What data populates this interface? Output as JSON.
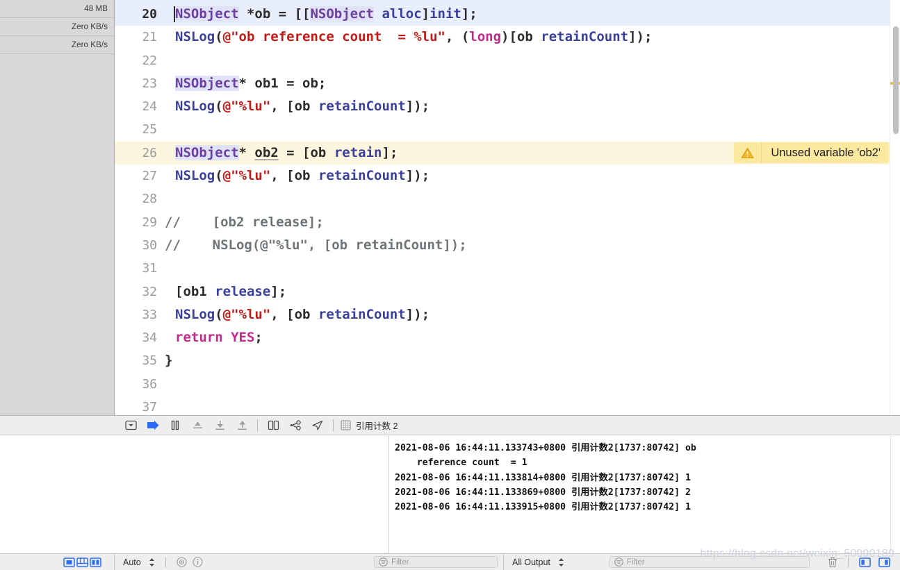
{
  "window": {
    "app": "Xcode",
    "project_breadcrumb": "引用计数 2"
  },
  "left_panel": {
    "name": "debug-gauges",
    "gauges": [
      {
        "value": "48 MB"
      },
      {
        "value": "Zero KB/s"
      },
      {
        "value": "Zero KB/s"
      }
    ]
  },
  "editor": {
    "language": "Objective-C",
    "selected_line": 20,
    "warning_line": 26,
    "partial_top_line_text": "   ...  ;",
    "lines": [
      {
        "num": "20",
        "state": "selected",
        "caret": true,
        "tokens": [
          {
            "t": "NSObject",
            "c": "t-cls-hl"
          },
          {
            "t": " *ob = [[",
            "c": "t-plain"
          },
          {
            "t": "NSObject",
            "c": "t-cls-hl"
          },
          {
            "t": " ",
            "c": "t-plain"
          },
          {
            "t": "alloc",
            "c": "t-call"
          },
          {
            "t": "]",
            "c": "t-plain"
          },
          {
            "t": "init",
            "c": "t-call"
          },
          {
            "t": "];",
            "c": "t-plain"
          }
        ]
      },
      {
        "num": "21",
        "state": "normal",
        "tokens": [
          {
            "t": "NSLog",
            "c": "t-call"
          },
          {
            "t": "(",
            "c": "t-plain"
          },
          {
            "t": "@\"ob reference count  = %lu\"",
            "c": "t-str"
          },
          {
            "t": ", (",
            "c": "t-plain"
          },
          {
            "t": "long",
            "c": "t-kw"
          },
          {
            "t": ")[ob ",
            "c": "t-plain"
          },
          {
            "t": "retainCount",
            "c": "t-call"
          },
          {
            "t": "]);",
            "c": "t-plain"
          }
        ]
      },
      {
        "num": "22",
        "state": "normal",
        "tokens": []
      },
      {
        "num": "23",
        "state": "normal",
        "tokens": [
          {
            "t": "NSObject",
            "c": "t-cls-hl"
          },
          {
            "t": "* ob1 = ob;",
            "c": "t-plain"
          }
        ]
      },
      {
        "num": "24",
        "state": "normal",
        "tokens": [
          {
            "t": "NSLog",
            "c": "t-call"
          },
          {
            "t": "(",
            "c": "t-plain"
          },
          {
            "t": "@\"%lu\"",
            "c": "t-str"
          },
          {
            "t": ", [ob ",
            "c": "t-plain"
          },
          {
            "t": "retainCount",
            "c": "t-call"
          },
          {
            "t": "]);",
            "c": "t-plain"
          }
        ]
      },
      {
        "num": "25",
        "state": "normal",
        "tokens": []
      },
      {
        "num": "26",
        "state": "warning",
        "tokens": [
          {
            "t": "NSObject",
            "c": "t-cls-hl"
          },
          {
            "t": "* ",
            "c": "t-plain"
          },
          {
            "t": "ob2",
            "c": "t-plain t-und"
          },
          {
            "t": " = [ob ",
            "c": "t-plain"
          },
          {
            "t": "retain",
            "c": "t-call"
          },
          {
            "t": "];",
            "c": "t-plain"
          }
        ]
      },
      {
        "num": "27",
        "state": "normal",
        "tokens": [
          {
            "t": "NSLog",
            "c": "t-call"
          },
          {
            "t": "(",
            "c": "t-plain"
          },
          {
            "t": "@\"%lu\"",
            "c": "t-str"
          },
          {
            "t": ", [ob ",
            "c": "t-plain"
          },
          {
            "t": "retainCount",
            "c": "t-call"
          },
          {
            "t": "]);",
            "c": "t-plain"
          }
        ]
      },
      {
        "num": "28",
        "state": "normal",
        "tokens": []
      },
      {
        "num": "29",
        "state": "normal",
        "nopad": true,
        "tokens": [
          {
            "t": "//    [ob2 release];",
            "c": "t-cmt"
          }
        ]
      },
      {
        "num": "30",
        "state": "normal",
        "nopad": true,
        "tokens": [
          {
            "t": "//    NSLog(@\"%lu\", [ob retainCount]);",
            "c": "t-cmt"
          }
        ]
      },
      {
        "num": "31",
        "state": "normal",
        "tokens": []
      },
      {
        "num": "32",
        "state": "normal",
        "tokens": [
          {
            "t": "[ob1 ",
            "c": "t-plain"
          },
          {
            "t": "release",
            "c": "t-call"
          },
          {
            "t": "];",
            "c": "t-plain"
          }
        ]
      },
      {
        "num": "33",
        "state": "normal",
        "tokens": [
          {
            "t": "NSLog",
            "c": "t-call"
          },
          {
            "t": "(",
            "c": "t-plain"
          },
          {
            "t": "@\"%lu\"",
            "c": "t-str"
          },
          {
            "t": ", [ob ",
            "c": "t-plain"
          },
          {
            "t": "retainCount",
            "c": "t-call"
          },
          {
            "t": "]);",
            "c": "t-plain"
          }
        ]
      },
      {
        "num": "34",
        "state": "normal",
        "tokens": [
          {
            "t": "return",
            "c": "t-kw"
          },
          {
            "t": " ",
            "c": "t-plain"
          },
          {
            "t": "YES",
            "c": "t-kw"
          },
          {
            "t": ";",
            "c": "t-plain"
          }
        ]
      },
      {
        "num": "35",
        "state": "normal",
        "nopad": true,
        "tokens": [
          {
            "t": "}",
            "c": "t-plain"
          }
        ]
      },
      {
        "num": "36",
        "state": "normal",
        "tokens": []
      },
      {
        "num": "37",
        "state": "normal",
        "tokens": []
      }
    ],
    "warning": {
      "icon": "warning-triangle-icon",
      "message": "Unused variable 'ob2'",
      "bg_color": "#fbe9a0"
    }
  },
  "debug_toolbar": {
    "buttons": [
      {
        "name": "hide-debug-area-button",
        "icon": "chevron-down-box-icon"
      },
      {
        "name": "continue-button",
        "icon": "continue-arrow-icon",
        "color": "#2d6df6"
      },
      {
        "name": "pause-button",
        "icon": "pause-bars-icon"
      },
      {
        "name": "step-over-button",
        "icon": "step-over-icon"
      },
      {
        "name": "step-into-button",
        "icon": "step-into-icon"
      },
      {
        "name": "step-out-button",
        "icon": "step-out-icon"
      },
      {
        "name": "debug-view-hierarchy-button",
        "icon": "view-hierarchy-icon"
      },
      {
        "name": "debug-memory-graph-button",
        "icon": "memory-graph-icon"
      },
      {
        "name": "simulate-location-button",
        "icon": "location-arrow-icon"
      }
    ],
    "breadcrumb": {
      "icon": "thread-grid-icon",
      "label": "引用计数 2"
    }
  },
  "console": {
    "lines": [
      "2021-08-06 16:44:11.133743+0800 引用计数2[1737:80742] ob",
      "    reference count  = 1",
      "2021-08-06 16:44:11.133814+0800 引用计数2[1737:80742] 1",
      "2021-08-06 16:44:11.133869+0800 引用计数2[1737:80742] 2",
      "2021-08-06 16:44:11.133915+0800 引用计数2[1737:80742] 1"
    ]
  },
  "status_bar": {
    "left_icons": [
      {
        "name": "show-navigator-toggle",
        "icon": "left-panel-icon"
      },
      {
        "name": "show-debug-area-toggle",
        "icon": "bottom-panel-icon"
      },
      {
        "name": "show-inspector-toggle",
        "icon": "right-panel-icon"
      }
    ],
    "variables_scope": {
      "label": "Auto",
      "stepper_icon": "up-down-chevron-icon",
      "watch_icon": "eye-icon",
      "info_icon": "info-circle-icon"
    },
    "variables_filter": {
      "icon": "filter-lines-icon",
      "placeholder": "Filter"
    },
    "console_scope": {
      "label": "All Output",
      "stepper_icon": "up-down-chevron-icon"
    },
    "console_filter": {
      "icon": "filter-lines-icon",
      "placeholder": "Filter"
    },
    "console_actions": [
      {
        "name": "clear-console-button",
        "icon": "trash-icon"
      },
      {
        "name": "show-variables-view-toggle",
        "icon": "left-split-icon"
      },
      {
        "name": "show-console-view-toggle",
        "icon": "right-split-icon"
      }
    ]
  },
  "watermark": {
    "text": "https://blog.csdn.net/weixin_50990189"
  }
}
